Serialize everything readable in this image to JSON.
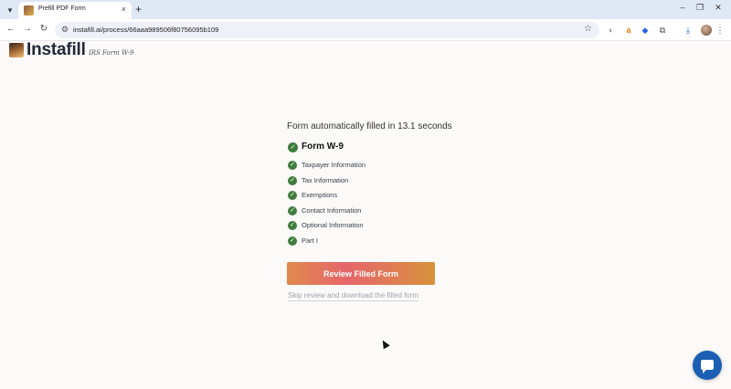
{
  "browser": {
    "tab_title": "Prefill PDF Form",
    "tab_close": "×",
    "new_tab": "+",
    "url": "instafill.ai/process/66aaa989506f80756095b109",
    "window_controls": {
      "minimize": "–",
      "maximize": "❐",
      "close": "✕"
    }
  },
  "app": {
    "brand_name": "Instafill",
    "brand_subtitle": "IRS Form W-9"
  },
  "main": {
    "headline": "Form automatically filled in 13.1 seconds",
    "form_name": "Form W-9",
    "sections": [
      "Taxpayer Information",
      "Tax Information",
      "Exemptions",
      "Contact Information",
      "Optional Information",
      "Part I"
    ],
    "review_button_label": "Review Filled Form",
    "skip_link_label": "Skip review and download the filled form"
  },
  "colors": {
    "check_green": "#3f7d3c",
    "chat_blue": "#1a5fb4",
    "button_gradient_start": "#e08a4d",
    "button_gradient_mid": "#e5666a",
    "button_gradient_end": "#d6923a"
  }
}
